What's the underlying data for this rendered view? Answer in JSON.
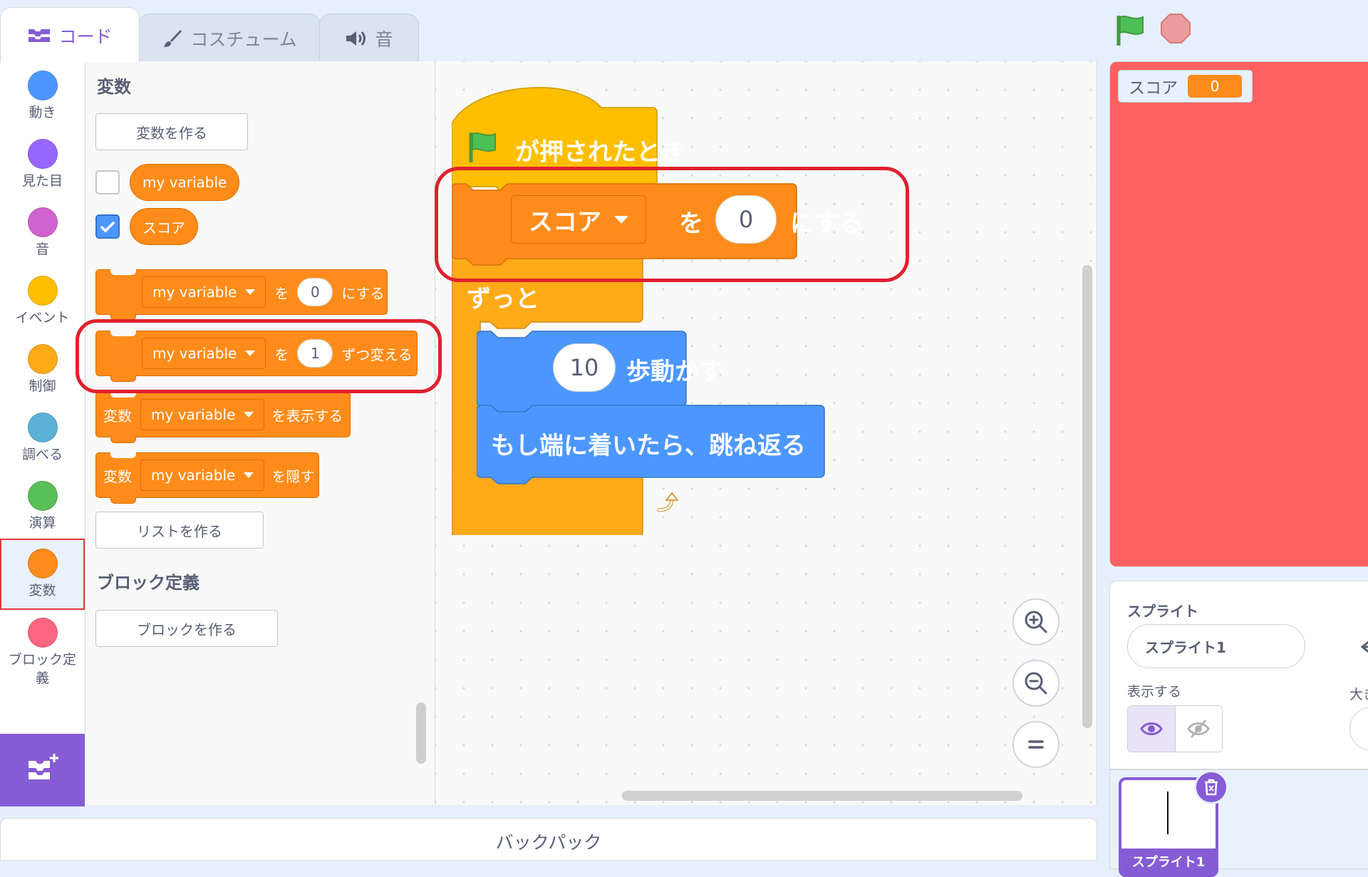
{
  "tabs": [
    {
      "label": "コード"
    },
    {
      "label": "コスチューム"
    },
    {
      "label": "音"
    }
  ],
  "categories": [
    {
      "label": "動き",
      "color": "#4c97ff"
    },
    {
      "label": "見た目",
      "color": "#9966ff"
    },
    {
      "label": "音",
      "color": "#cf63cf"
    },
    {
      "label": "イベント",
      "color": "#ffbf00"
    },
    {
      "label": "制御",
      "color": "#ffab19"
    },
    {
      "label": "調べる",
      "color": "#5cb1d6"
    },
    {
      "label": "演算",
      "color": "#59c059"
    },
    {
      "label": "変数",
      "color": "#ff8c1a"
    },
    {
      "label": "ブロック定義",
      "color": "#ff6680"
    }
  ],
  "palette": {
    "variables_title": "変数",
    "make_variable": "変数を作る",
    "var1": "my variable",
    "var2": "スコア",
    "set_block": {
      "var": "my variable",
      "to": "を",
      "value": "0",
      "suffix": "にする"
    },
    "change_block": {
      "var": "my variable",
      "to": "を",
      "value": "1",
      "suffix": "ずつ変える"
    },
    "show_block": {
      "prefix": "変数",
      "var": "my variable",
      "suffix": "を表示する"
    },
    "hide_block": {
      "prefix": "変数",
      "var": "my variable",
      "suffix": "を隠す"
    },
    "make_list": "リストを作る",
    "myblocks_title": "ブロック定義",
    "make_block": "ブロックを作る"
  },
  "script": {
    "hat": "が押されたとき",
    "set": {
      "var": "スコア",
      "to": "を",
      "value": "0",
      "suffix": "にする"
    },
    "forever": "ずっと",
    "move": {
      "value": "10",
      "suffix": "歩動かす"
    },
    "bounce": "もし端に着いたら、跳ね返る"
  },
  "stage": {
    "monitor_label": "スコア",
    "monitor_value": "0"
  },
  "sprite_info": {
    "sprite_label": "スプライト",
    "sprite_name": "スプライト1",
    "show_label": "表示する",
    "size_label_partial": "大き"
  },
  "sprite_list": {
    "thumb_name": "スプライト1"
  },
  "backpack": "バックパック",
  "colors": {
    "variables": "#ff8c1a",
    "events": "#ffbf00",
    "control": "#ffab19",
    "motion": "#4c97ff",
    "highlight": "#e0212e",
    "stage_bg": "#ff6161",
    "accent": "#855cd6"
  }
}
